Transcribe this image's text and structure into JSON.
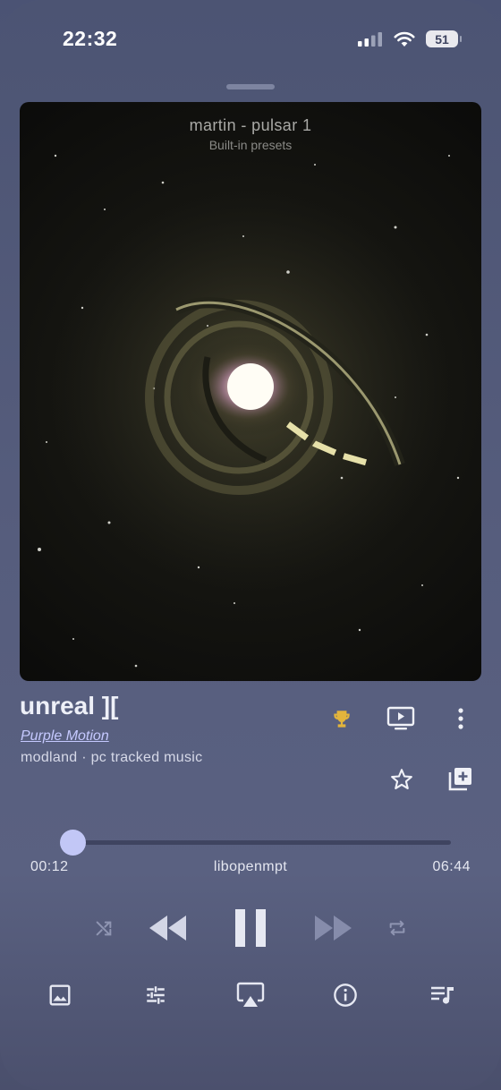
{
  "status_bar": {
    "time": "22:32",
    "battery": "51"
  },
  "visualizer": {
    "preset_title": "martin - pulsar 1",
    "preset_subtitle": "Built-in presets"
  },
  "track": {
    "title": "unreal ][",
    "artist": "Purple Motion",
    "source": "modland · pc tracked music"
  },
  "playback": {
    "elapsed": "00:12",
    "duration": "06:44",
    "engine": "libopenmpt",
    "progress_fraction": 0.031
  },
  "icons": {
    "trophy": "trophy-icon",
    "visualizer": "tv-play-icon",
    "more": "more-vertical-icon",
    "favorite": "star-outline-icon",
    "add_to_playlist": "playlist-add-icon",
    "shuffle": "shuffle-icon",
    "rewind": "rewind-icon",
    "pause": "pause-icon",
    "fast_forward": "fast-forward-icon",
    "repeat": "repeat-icon",
    "artwork": "image-icon",
    "equalizer": "equalizer-sliders-icon",
    "airplay": "airplay-icon",
    "info": "info-icon",
    "queue": "queue-music-icon"
  },
  "colors": {
    "accent": "#c2c7f6",
    "trophy": "#e2b43c",
    "link": "#c5c9ff"
  }
}
